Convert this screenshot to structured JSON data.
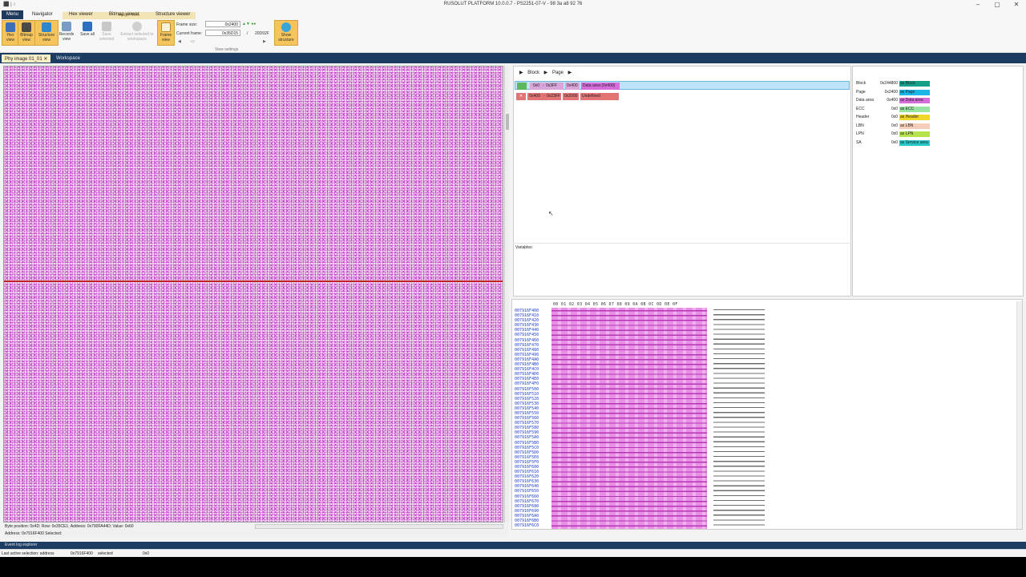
{
  "window": {
    "title": "RUSOLUT PLATFORM 10.0.0.7 - PS2251-07-V - 98 3a a8 92 76",
    "quick_access": "⬛ | ↕",
    "minimize": "–",
    "maximize": "▢",
    "close": "✕"
  },
  "ribbon": {
    "tabs": [
      "Menu",
      "Navigator",
      "Hex viewer",
      "Bitmap viewer",
      "Structure viewer"
    ],
    "context_header": "Image Tools",
    "buttons": {
      "hex_view": "Hex view",
      "bitmap_view": "Bitmap view",
      "structure_view": "Structure view",
      "records_view": "Records view",
      "save_all": "Save all",
      "save_selected": "Save selected",
      "extract_selected": "Extract selected to workspace",
      "frame_view": "Frame view",
      "show_structure": "Show structure"
    },
    "frame_size_label": "Frame size:",
    "frame_size_value": "0x2400",
    "current_frame_label": "Current frame:",
    "current_frame_value": "0x35D15",
    "frame_total": "20D92F",
    "frame_sep": "/",
    "group_label": "View settings"
  },
  "doc_tabs": [
    {
      "label": "Phy image 01_01"
    },
    {
      "label": "Workspace"
    }
  ],
  "bitmap": {
    "status_line": "Byte position: 0x4D; Row: 0x35CE1; Address: 0x790FA44D; Value: 0x60",
    "address_line": "Address:   0x7916F400   Selected:"
  },
  "structure": {
    "breadcrumb": [
      "Block",
      "Page"
    ],
    "rows": [
      {
        "range_start": "0x0",
        "range_end": "0x3FF",
        "size": "0x400",
        "label": "Data area (0x400)"
      },
      {
        "range_start": "0x400",
        "range_end": "0x23FF",
        "size": "0x2000",
        "label": "Undefined"
      }
    ],
    "variables_label": "Variables:"
  },
  "legend": [
    {
      "name": "Block",
      "value": "0x244800",
      "tag": "as Block",
      "color": "#17a089"
    },
    {
      "name": "Page",
      "value": "0x2400",
      "tag": "as Page",
      "color": "#19b6e6"
    },
    {
      "name": "Data area",
      "value": "0x400",
      "tag": "as Data area",
      "color": "#d66ddb"
    },
    {
      "name": "ECC",
      "value": "0x0",
      "tag": "as ECC",
      "color": "#98e4a0"
    },
    {
      "name": "Header",
      "value": "0x0",
      "tag": "as Header",
      "color": "#f1d62a"
    },
    {
      "name": "LBN",
      "value": "0x0",
      "tag": "as LBN",
      "color": "#f6cdb8"
    },
    {
      "name": "LPN",
      "value": "0x0",
      "tag": "as LPN",
      "color": "#b6e24c"
    },
    {
      "name": "SA",
      "value": "0x0",
      "tag": "as Service area",
      "color": "#28c8c8"
    }
  ],
  "hex": {
    "header": "00 01 02 03 04 05 06 07 08 09 0A 0B 0C 0D 0E 0F",
    "addresses": [
      "007916F400",
      "007916F410",
      "007916F420",
      "007916F430",
      "007916F440",
      "007916F450",
      "007916F460",
      "007916F470",
      "007916F480",
      "007916F490",
      "007916F4A0",
      "007916F4B0",
      "007916F4C0",
      "007916F4D0",
      "007916F4E0",
      "007916F4F0",
      "007916F500",
      "007916F510",
      "007916F520",
      "007916F530",
      "007916F540",
      "007916F550",
      "007916F560",
      "007916F570",
      "007916F580",
      "007916F590",
      "007916F5A0",
      "007916F5B0",
      "007916F5C0",
      "007916F5D0",
      "007916F5E0",
      "007916F5F0",
      "007916F600",
      "007916F610",
      "007916F620",
      "007916F630",
      "007916F640",
      "007916F650",
      "007916F660",
      "007916F670",
      "007916F680",
      "007916F690",
      "007916F6A0",
      "007916F6B0",
      "007916F6C0"
    ]
  },
  "bottom": {
    "event_log": "Event log explorer",
    "status_label": "Last active selection:  address",
    "status_addr": "0x7916F400",
    "status_sel": "selected",
    "status_val": "0x0"
  }
}
